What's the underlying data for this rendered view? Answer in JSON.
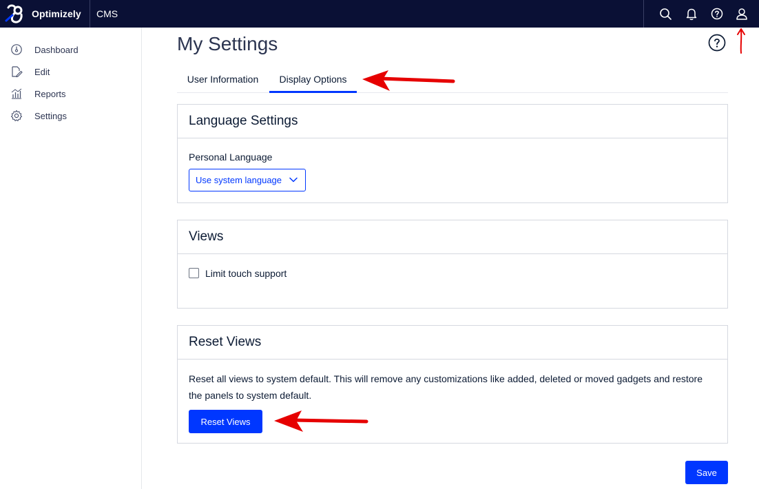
{
  "topbar": {
    "brand": "Optimizely",
    "product": "CMS",
    "icons": [
      "search-icon",
      "bell-icon",
      "help-icon",
      "user-icon"
    ]
  },
  "sidebar": {
    "items": [
      {
        "label": "Dashboard",
        "icon": "dashboard-icon"
      },
      {
        "label": "Edit",
        "icon": "edit-icon"
      },
      {
        "label": "Reports",
        "icon": "reports-icon"
      },
      {
        "label": "Settings",
        "icon": "gear-icon"
      }
    ]
  },
  "main": {
    "title": "My Settings",
    "tabs": [
      {
        "label": "User Information",
        "active": false
      },
      {
        "label": "Display Options",
        "active": true
      }
    ],
    "language": {
      "heading": "Language Settings",
      "field_label": "Personal Language",
      "selected": "Use system language"
    },
    "views": {
      "heading": "Views",
      "checkbox_label": "Limit touch support",
      "checked": false
    },
    "reset": {
      "heading": "Reset Views",
      "description": "Reset all views to system default. This will remove any customizations like added, deleted or moved gadgets and restore the panels to system default.",
      "button": "Reset Views"
    },
    "save": "Save"
  },
  "colors": {
    "topbar": "#0a1035",
    "accent": "#0037ff",
    "annotation": "#e60000"
  }
}
